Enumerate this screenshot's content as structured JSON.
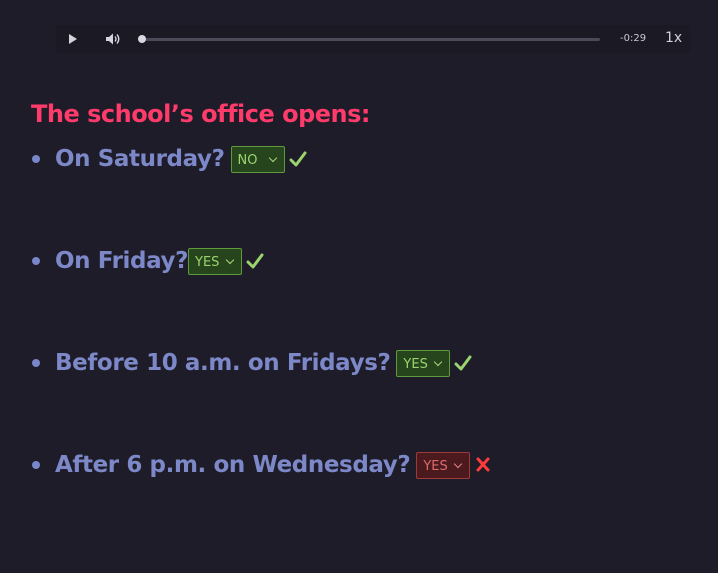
{
  "player": {
    "time": "-0:29",
    "speed": "1x",
    "progress": 0
  },
  "heading": "The school’s office opens:",
  "questions": [
    {
      "text": "On Saturday?",
      "answer": "NO",
      "status": "correct"
    },
    {
      "text": "On Friday?",
      "answer": "YES",
      "status": "correct"
    },
    {
      "text": "Before 10 a.m. on Fridays?",
      "answer": "YES",
      "status": "correct"
    },
    {
      "text": "After 6 p.m. on Wednesday?",
      "answer": "YES",
      "status": "incorrect"
    }
  ],
  "colors": {
    "background": "#1d1c28",
    "heading": "#ff3b6b",
    "question": "#7d88c8",
    "correct": "#9bd36f",
    "incorrect": "#ff3b3b"
  },
  "icons": {
    "play": "play-icon",
    "volume": "volume-icon",
    "correct": "checkmark-icon",
    "incorrect": "cross-icon"
  }
}
